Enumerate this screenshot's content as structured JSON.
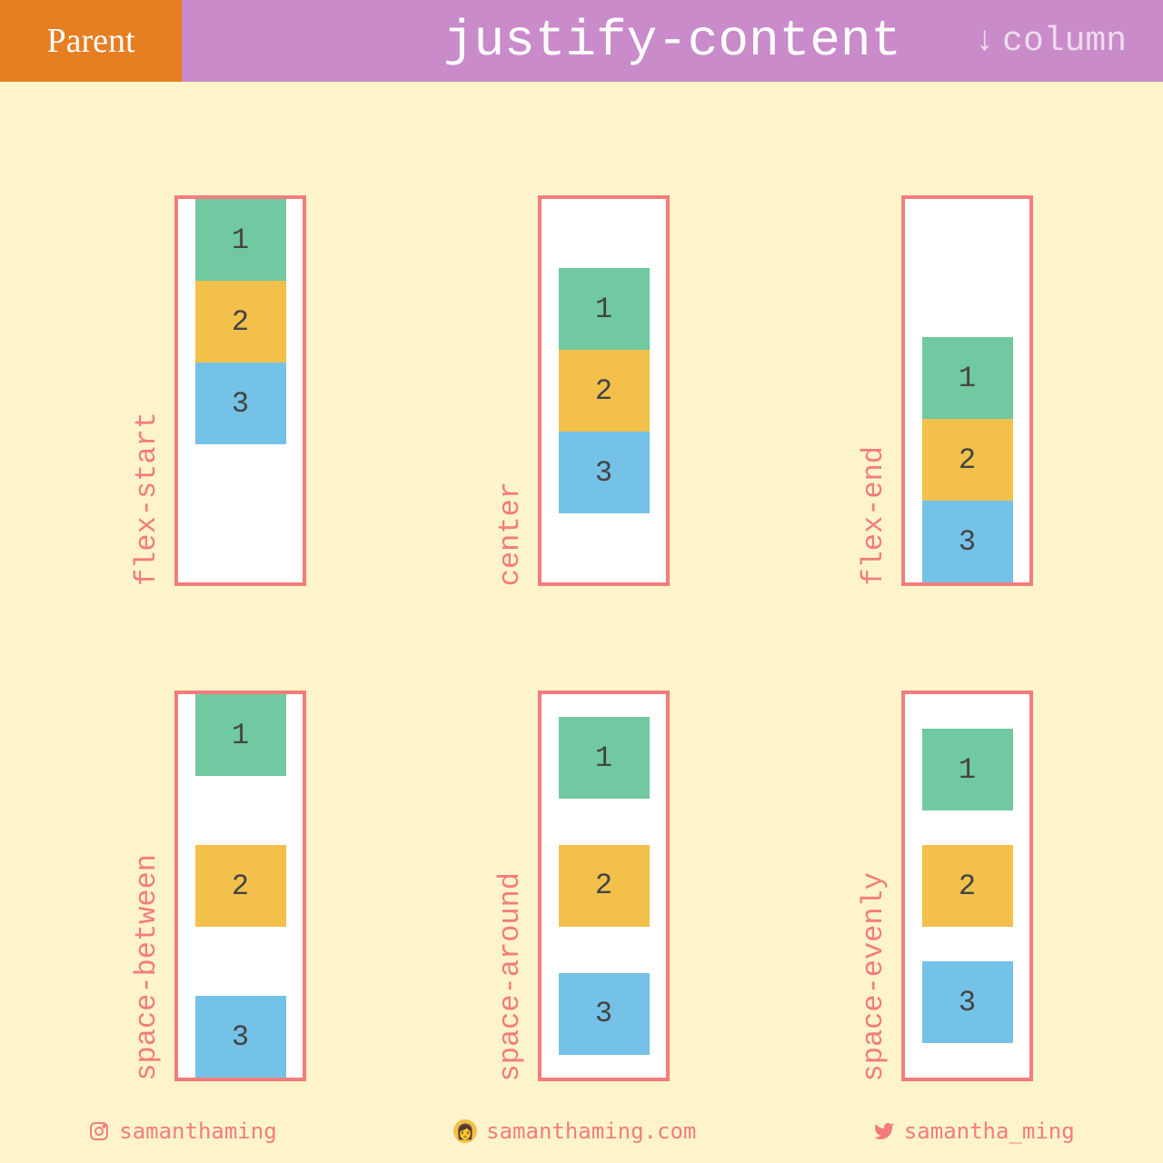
{
  "header": {
    "parent_label": "Parent",
    "title": "justify-content",
    "direction_arrow": "↓",
    "direction_label": "column"
  },
  "boxes": {
    "item1": "1",
    "item2": "2",
    "item3": "3"
  },
  "demos": [
    {
      "label": "flex-start",
      "value": "flex-start"
    },
    {
      "label": "center",
      "value": "center"
    },
    {
      "label": "flex-end",
      "value": "flex-end"
    },
    {
      "label": "space-between",
      "value": "space-between"
    },
    {
      "label": "space-around",
      "value": "space-around"
    },
    {
      "label": "space-evenly",
      "value": "space-evenly"
    }
  ],
  "footer": {
    "instagram": "samanthaming",
    "website": "samanthaming.com",
    "twitter": "samantha_ming"
  },
  "colors": {
    "background": "#fdf4cb",
    "orange": "#e67e22",
    "purple": "#c98bc9",
    "salmon": "#f47c7c",
    "green": "#70c9a0",
    "yellow": "#f3c14b",
    "blue": "#75c2e8"
  }
}
